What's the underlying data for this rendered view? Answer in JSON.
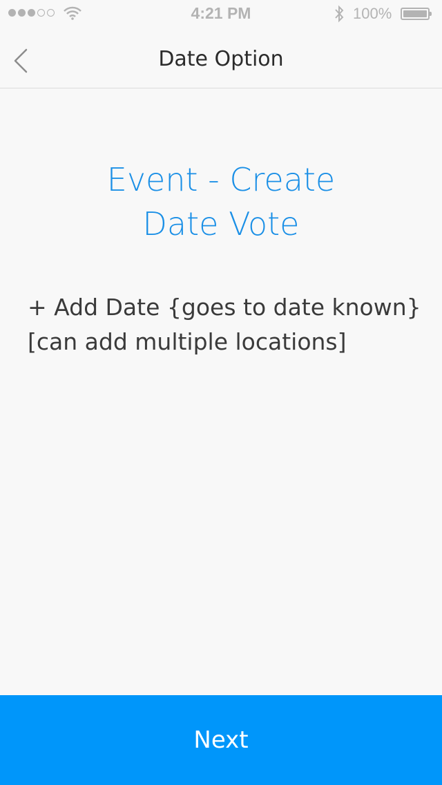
{
  "status_bar": {
    "time": "4:21 PM",
    "battery_percent": "100%",
    "signal_bars_filled": 3,
    "signal_bars_total": 5,
    "battery_level": 1.0,
    "icons": [
      "signal-dots-icon",
      "wifi-icon",
      "bluetooth-icon",
      "battery-icon"
    ]
  },
  "nav": {
    "title": "Date Option",
    "back_icon": "chevron-left-icon"
  },
  "main": {
    "heading_line1": "Event - Create",
    "heading_line2": "Date Vote",
    "body_line1": "+ Add Date {goes to date known}",
    "body_line2": "[can add multiple locations]"
  },
  "footer": {
    "next_label": "Next"
  },
  "colors": {
    "accent": "#1a8fe6",
    "button_bg": "#0096fa",
    "background": "#f8f8f8"
  }
}
